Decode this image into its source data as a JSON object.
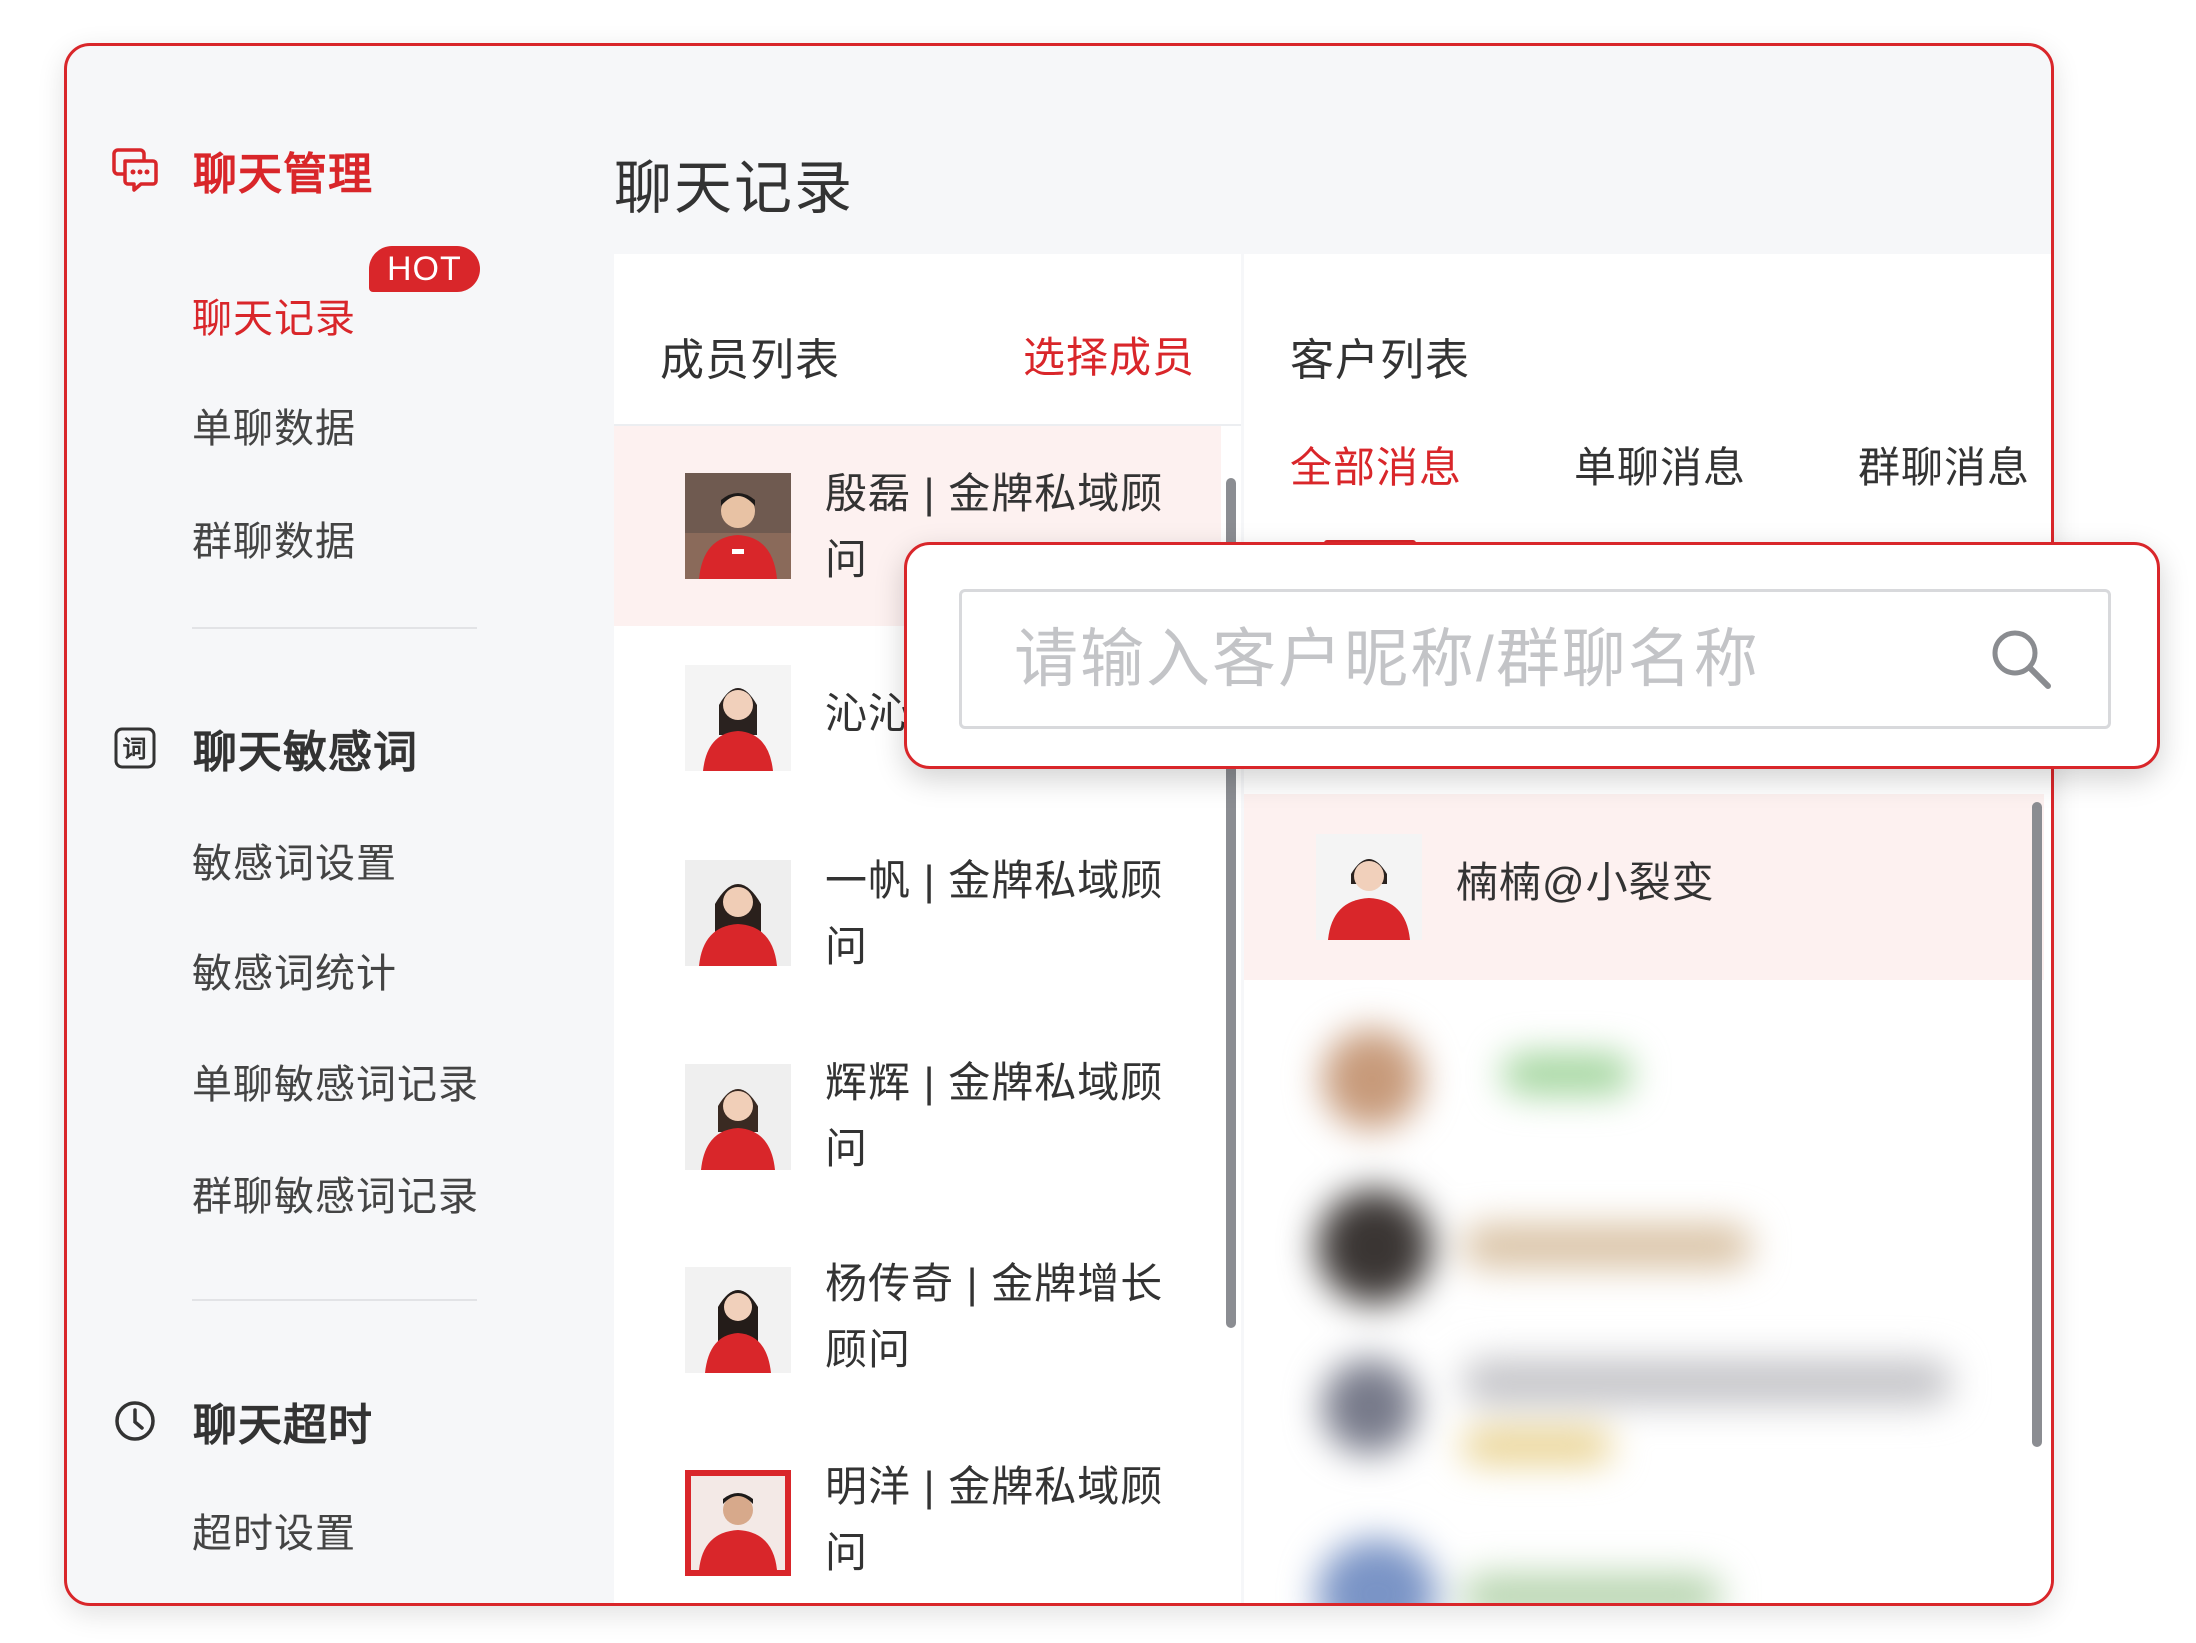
{
  "sidebar": {
    "sections": [
      {
        "title": "聊天管理",
        "icon": "chat-bubble-icon",
        "items": [
          "聊天记录",
          "单聊数据",
          "群聊数据"
        ]
      },
      {
        "title": "聊天敏感词",
        "icon": "word-icon",
        "icon_glyph": "词",
        "items": [
          "敏感词设置",
          "敏感词统计",
          "单聊敏感词记录",
          "群聊敏感词记录"
        ]
      },
      {
        "title": "聊天超时",
        "icon": "clock-icon",
        "items": [
          "超时设置"
        ]
      }
    ],
    "active_item": "聊天记录",
    "hot_badge": "HOT"
  },
  "page": {
    "title": "聊天记录"
  },
  "members": {
    "title": "成员列表",
    "select_label": "选择成员",
    "list": [
      {
        "name": "殷磊 | 金牌私域顾问",
        "selected": true
      },
      {
        "name": "沁沁",
        "selected": false
      },
      {
        "name": "一帆 | 金牌私域顾问",
        "selected": false
      },
      {
        "name": "辉辉 | 金牌私域顾问",
        "selected": false
      },
      {
        "name": "杨传奇 | 金牌增长顾问",
        "selected": false
      },
      {
        "name": "明洋 | 金牌私域顾问",
        "selected": false
      }
    ]
  },
  "customers": {
    "title": "客户列表",
    "tabs": [
      "全部消息",
      "单聊消息",
      "群聊消息"
    ],
    "active_tab": "全部消息",
    "search": {
      "placeholder": "请输入客户昵称/群聊名称",
      "value": ""
    },
    "list": [
      {
        "name": "楠楠@小裂变",
        "selected": true
      }
    ]
  },
  "colors": {
    "accent": "#d9262a",
    "selected_bg": "#fdf1f0",
    "sidebar_bg": "#f6f7f9"
  }
}
